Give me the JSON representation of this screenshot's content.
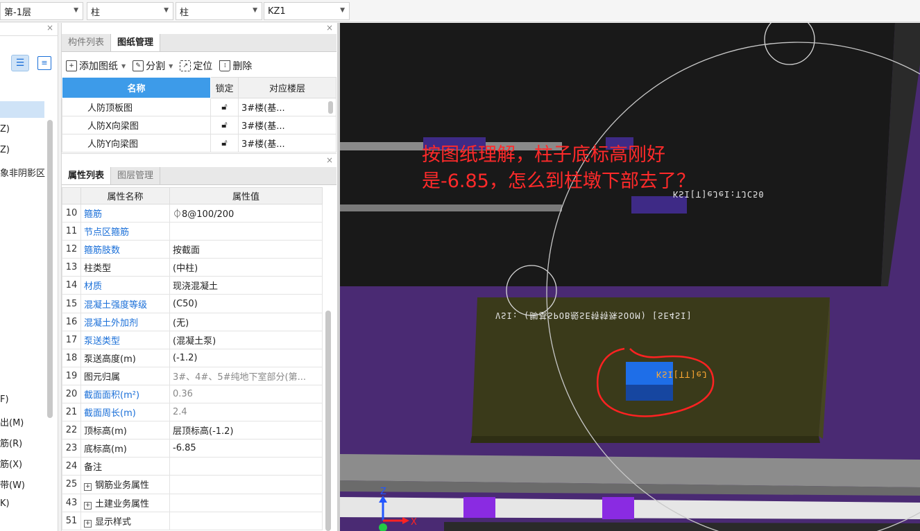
{
  "toolbar": {
    "floor": "第-1层",
    "type1": "柱",
    "type2": "柱",
    "component": "KZ1"
  },
  "left_panel": {
    "items": [
      "Z)",
      "Z)",
      "象非阴影区",
      "F)",
      "出(M)",
      "筋(R)",
      "筋(X)",
      "带(W)",
      "K)"
    ]
  },
  "drawing_panel": {
    "tabs": [
      "构件列表",
      "图纸管理"
    ],
    "toolbar": {
      "add": "添加图纸",
      "split": "分割",
      "locate": "定位",
      "delete": "删除"
    },
    "headers": [
      "名称",
      "锁定",
      "对应楼层"
    ],
    "rows": [
      {
        "name": "人防顶板图",
        "floor": "3#楼(基..."
      },
      {
        "name": "人防X向梁图",
        "floor": "3#楼(基..."
      },
      {
        "name": "人防Y向梁图",
        "floor": "3#楼(基..."
      }
    ]
  },
  "property_panel": {
    "tabs": [
      "属性列表",
      "图层管理"
    ],
    "headers": [
      "属性名称",
      "属性值"
    ],
    "rows": [
      {
        "n": "10",
        "k": "箍筋",
        "v": "⏀8@100/200",
        "kc": "blue",
        "vc": ""
      },
      {
        "n": "11",
        "k": "节点区箍筋",
        "v": "",
        "kc": "blue",
        "vc": ""
      },
      {
        "n": "12",
        "k": "箍筋肢数",
        "v": "按截面",
        "kc": "blue",
        "vc": ""
      },
      {
        "n": "13",
        "k": "柱类型",
        "v": "(中柱)",
        "kc": "",
        "vc": ""
      },
      {
        "n": "14",
        "k": "材质",
        "v": "现浇混凝土",
        "kc": "blue",
        "vc": ""
      },
      {
        "n": "15",
        "k": "混凝土强度等级",
        "v": "(C50)",
        "kc": "blue",
        "vc": ""
      },
      {
        "n": "16",
        "k": "混凝土外加剂",
        "v": "(无)",
        "kc": "blue",
        "vc": ""
      },
      {
        "n": "17",
        "k": "泵送类型",
        "v": "(混凝土泵)",
        "kc": "blue",
        "vc": ""
      },
      {
        "n": "18",
        "k": "泵送高度(m)",
        "v": "(-1.2)",
        "kc": "",
        "vc": ""
      },
      {
        "n": "19",
        "k": "图元归属",
        "v": "3#、4#、5#纯地下室部分(第...",
        "kc": "",
        "vc": "gray"
      },
      {
        "n": "20",
        "k": "截面面积(m²)",
        "v": "0.36",
        "kc": "blue",
        "vc": "gray"
      },
      {
        "n": "21",
        "k": "截面周长(m)",
        "v": "2.4",
        "kc": "blue",
        "vc": "gray"
      },
      {
        "n": "22",
        "k": "顶标高(m)",
        "v": "层顶标高(-1.2)",
        "kc": "",
        "vc": ""
      },
      {
        "n": "23",
        "k": "底标高(m)",
        "v": "-6.85",
        "kc": "",
        "vc": ""
      },
      {
        "n": "24",
        "k": "备注",
        "v": "",
        "kc": "",
        "vc": ""
      },
      {
        "n": "25",
        "k": "钢筋业务属性",
        "v": "",
        "kc": "",
        "vc": "",
        "group": true
      },
      {
        "n": "43",
        "k": "土建业务属性",
        "v": "",
        "kc": "",
        "vc": "",
        "group": true
      },
      {
        "n": "51",
        "k": "显示样式",
        "v": "",
        "kc": "",
        "vc": "",
        "group": true
      }
    ]
  },
  "viewport": {
    "note_line1": "按图纸理解，柱子底标高刚好",
    "note_line2": "是-6.85，怎么到柱墩下部去了？",
    "label_beam": "KSI[T]eJeI:TJC50",
    "label_cap": "VSI: (脚基SPOB般SE特特殊SOOM) [SE4SI]",
    "label_col": "KSI[TT]eJ",
    "axis_x": "X",
    "axis_z": "Z"
  }
}
